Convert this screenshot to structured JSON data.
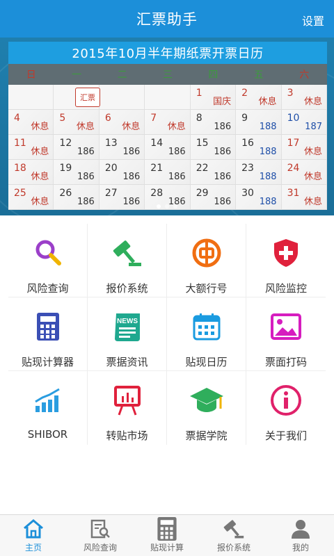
{
  "header": {
    "title": "汇票助手",
    "settings": "设置"
  },
  "calendar": {
    "title": "2015年10月半年期纸票开票日历",
    "weekdays": [
      "日",
      "一",
      "二",
      "三",
      "四",
      "五",
      "六"
    ],
    "stamp": "汇票",
    "rows": [
      [
        {
          "day": "",
          "sub": "",
          "empty": true
        },
        {
          "day": "",
          "sub": "",
          "empty": true
        },
        {
          "day": "",
          "sub": "",
          "empty": true
        },
        {
          "day": "",
          "sub": "",
          "empty": true
        },
        {
          "day": "1",
          "sub": "国庆",
          "dayColor": "red",
          "subColor": "red"
        },
        {
          "day": "2",
          "sub": "休息",
          "dayColor": "red",
          "subColor": "red"
        },
        {
          "day": "3",
          "sub": "休息",
          "dayColor": "red",
          "subColor": "red"
        }
      ],
      [
        {
          "day": "4",
          "sub": "休息",
          "dayColor": "red",
          "subColor": "red"
        },
        {
          "day": "5",
          "sub": "休息",
          "dayColor": "red",
          "subColor": "red"
        },
        {
          "day": "6",
          "sub": "休息",
          "dayColor": "red",
          "subColor": "red"
        },
        {
          "day": "7",
          "sub": "休息",
          "dayColor": "red",
          "subColor": "red"
        },
        {
          "day": "8",
          "sub": "186",
          "dayColor": "",
          "subColor": ""
        },
        {
          "day": "9",
          "sub": "188",
          "dayColor": "",
          "subColor": "blue"
        },
        {
          "day": "10",
          "sub": "187",
          "dayColor": "blue",
          "subColor": "blue"
        }
      ],
      [
        {
          "day": "11",
          "sub": "休息",
          "dayColor": "red",
          "subColor": "red"
        },
        {
          "day": "12",
          "sub": "186",
          "dayColor": "",
          "subColor": ""
        },
        {
          "day": "13",
          "sub": "186",
          "dayColor": "",
          "subColor": ""
        },
        {
          "day": "14",
          "sub": "186",
          "dayColor": "",
          "subColor": ""
        },
        {
          "day": "15",
          "sub": "186",
          "dayColor": "",
          "subColor": ""
        },
        {
          "day": "16",
          "sub": "188",
          "dayColor": "",
          "subColor": "blue"
        },
        {
          "day": "17",
          "sub": "休息",
          "dayColor": "red",
          "subColor": "red"
        }
      ],
      [
        {
          "day": "18",
          "sub": "休息",
          "dayColor": "red",
          "subColor": "red"
        },
        {
          "day": "19",
          "sub": "186",
          "dayColor": "",
          "subColor": ""
        },
        {
          "day": "20",
          "sub": "186",
          "dayColor": "",
          "subColor": ""
        },
        {
          "day": "21",
          "sub": "186",
          "dayColor": "",
          "subColor": ""
        },
        {
          "day": "22",
          "sub": "186",
          "dayColor": "",
          "subColor": ""
        },
        {
          "day": "23",
          "sub": "188",
          "dayColor": "",
          "subColor": "blue"
        },
        {
          "day": "24",
          "sub": "休息",
          "dayColor": "red",
          "subColor": "red"
        }
      ],
      [
        {
          "day": "25",
          "sub": "休息",
          "dayColor": "red",
          "subColor": "red"
        },
        {
          "day": "26",
          "sub": "186",
          "dayColor": "",
          "subColor": ""
        },
        {
          "day": "27",
          "sub": "186",
          "dayColor": "",
          "subColor": ""
        },
        {
          "day": "28",
          "sub": "186",
          "dayColor": "",
          "subColor": ""
        },
        {
          "day": "29",
          "sub": "186",
          "dayColor": "",
          "subColor": ""
        },
        {
          "day": "30",
          "sub": "188",
          "dayColor": "",
          "subColor": "blue"
        },
        {
          "day": "31",
          "sub": "休息",
          "dayColor": "red",
          "subColor": "red"
        }
      ]
    ]
  },
  "functions": [
    {
      "label": "风险查询",
      "icon": "magnifier-icon",
      "color": "#9b3fc9"
    },
    {
      "label": "报价系统",
      "icon": "gavel-icon",
      "color": "#2fae5c"
    },
    {
      "label": "大额行号",
      "icon": "bank-of-china-icon",
      "color": "#f06e12"
    },
    {
      "label": "风险监控",
      "icon": "shield-plus-icon",
      "color": "#e0213c"
    },
    {
      "label": "贴现计算器",
      "icon": "calculator-icon",
      "color": "#3b4fb5"
    },
    {
      "label": "票据资讯",
      "icon": "news-icon",
      "color": "#1fa88f"
    },
    {
      "label": "贴现日历",
      "icon": "calendar-icon",
      "color": "#1a9be0"
    },
    {
      "label": "票面打码",
      "icon": "image-icon",
      "color": "#d61dbf"
    },
    {
      "label": "SHIBOR",
      "icon": "trend-chart-icon",
      "color": "#2a9de0"
    },
    {
      "label": "转贴市场",
      "icon": "easel-chart-icon",
      "color": "#e0213c"
    },
    {
      "label": "票据学院",
      "icon": "graduation-cap-icon",
      "color": "#2fae5c"
    },
    {
      "label": "关于我们",
      "icon": "info-icon",
      "color": "#e0216a"
    }
  ],
  "tabs": [
    {
      "label": "主页",
      "icon": "home-icon",
      "active": true
    },
    {
      "label": "风险查询",
      "icon": "search-doc-icon",
      "active": false
    },
    {
      "label": "贴现计算",
      "icon": "calculator-icon",
      "active": false
    },
    {
      "label": "报价系统",
      "icon": "gavel-icon",
      "active": false
    },
    {
      "label": "我的",
      "icon": "user-icon",
      "active": false
    }
  ],
  "colors": {
    "accent": "#1c8fd9",
    "holiday": "#c0392b",
    "rate_high": "#1f4fa8"
  }
}
